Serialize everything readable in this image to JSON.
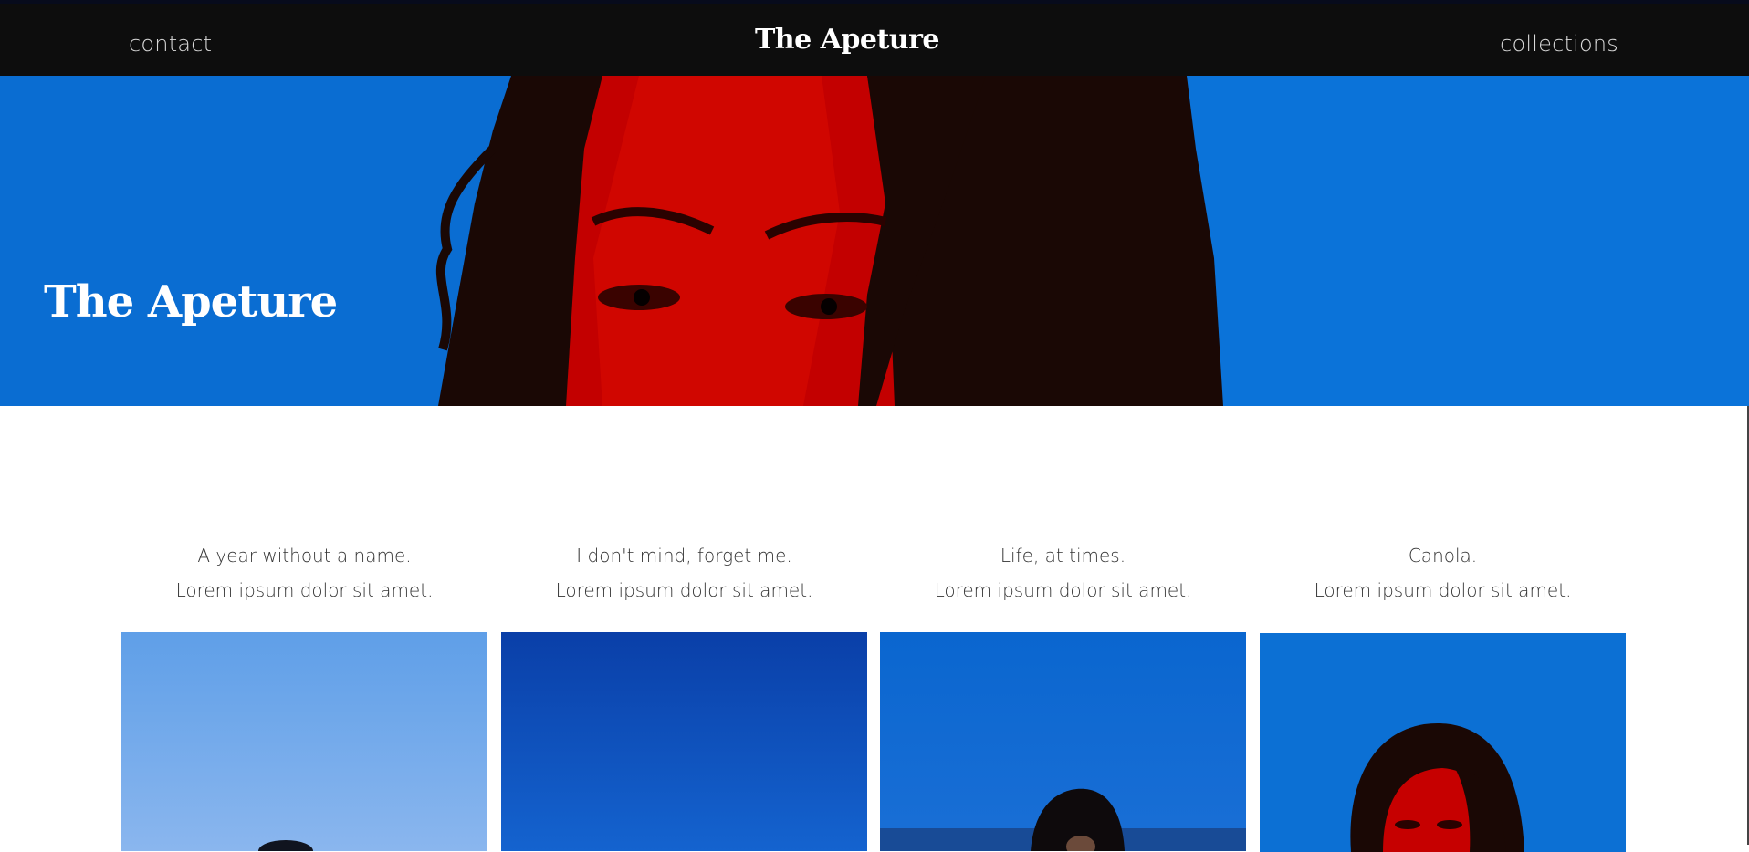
{
  "nav": {
    "contact_label": "contact",
    "brand": "The Apeture",
    "collections_label": "collections"
  },
  "hero": {
    "title": "The Apeture"
  },
  "collections": [
    {
      "title": "A year without a name.",
      "subtitle": "Lorem ipsum dolor sit amet."
    },
    {
      "title": "I don't mind, forget me.",
      "subtitle": "Lorem ipsum dolor sit amet."
    },
    {
      "title": "Life, at times.",
      "subtitle": "Lorem ipsum dolor sit amet."
    },
    {
      "title": "Canola.",
      "subtitle": "Lorem ipsum dolor sit amet."
    }
  ],
  "colors": {
    "nav_bg": "#0d0d0d",
    "sky_blue": "#0b74db",
    "face_red": "#d40000",
    "hair": "#1a0805"
  }
}
